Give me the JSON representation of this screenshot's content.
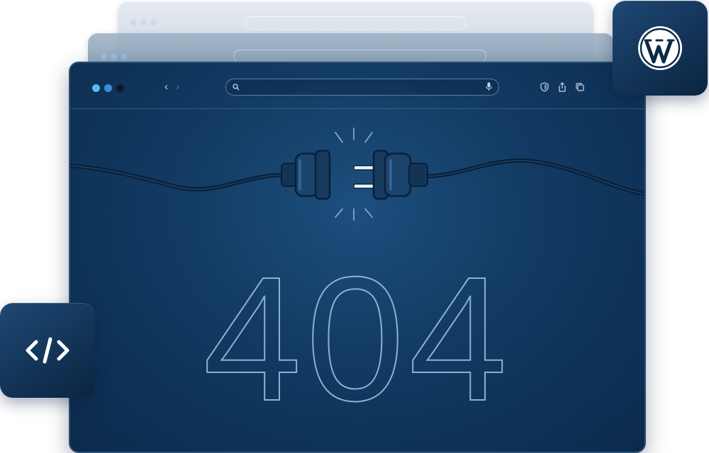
{
  "browser": {
    "dots": [
      "#5bb8ef",
      "#3a8fd8",
      "#0b1a2e"
    ],
    "address_bar": {
      "value": "",
      "placeholder": ""
    },
    "nav": {
      "back": "‹",
      "forward": "›"
    },
    "tools": [
      "shield-icon",
      "share-icon",
      "tabs-icon"
    ]
  },
  "content": {
    "error_code": "404"
  },
  "badges": {
    "left": "code-icon",
    "right": "wordpress-icon"
  },
  "colors": {
    "accent": "#5bb8ef",
    "background": "#123a62",
    "outline": "#8fb0d2"
  }
}
